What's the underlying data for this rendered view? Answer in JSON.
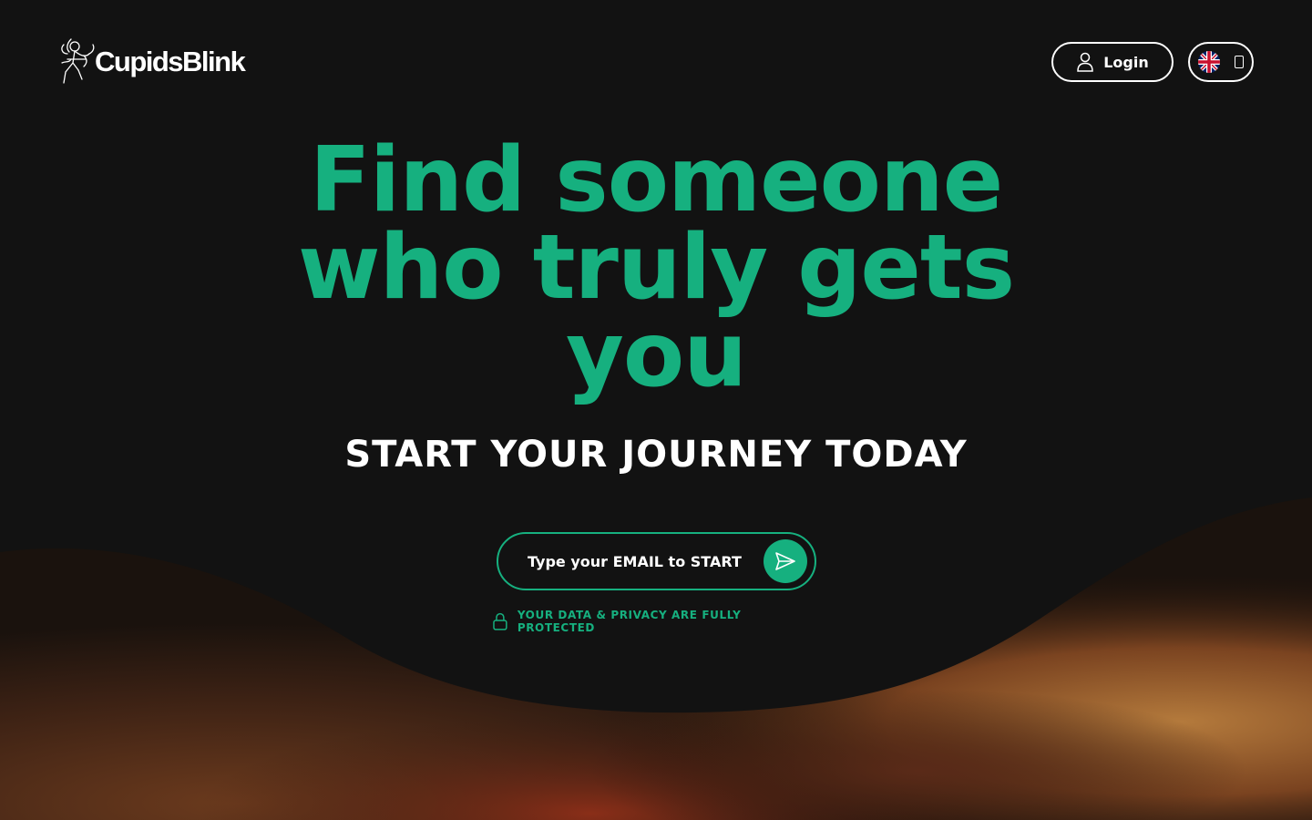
{
  "header": {
    "brand": "CupidsBlink",
    "login_label": "Login"
  },
  "hero": {
    "title": "Find someone who truly gets you",
    "subtitle": "START YOUR JOURNEY TODAY"
  },
  "signup": {
    "email_placeholder": "Type your EMAIL to START",
    "privacy_note": "YOUR DATA & PRIVACY ARE FULLY PROTECTED"
  },
  "colors": {
    "accent": "#16b07f",
    "background": "#121212",
    "text": "#ffffff"
  },
  "icons": {
    "logo": "cupid-icon",
    "login": "user-icon",
    "language": "uk-flag-icon",
    "send": "send-icon",
    "privacy": "lock-icon"
  }
}
